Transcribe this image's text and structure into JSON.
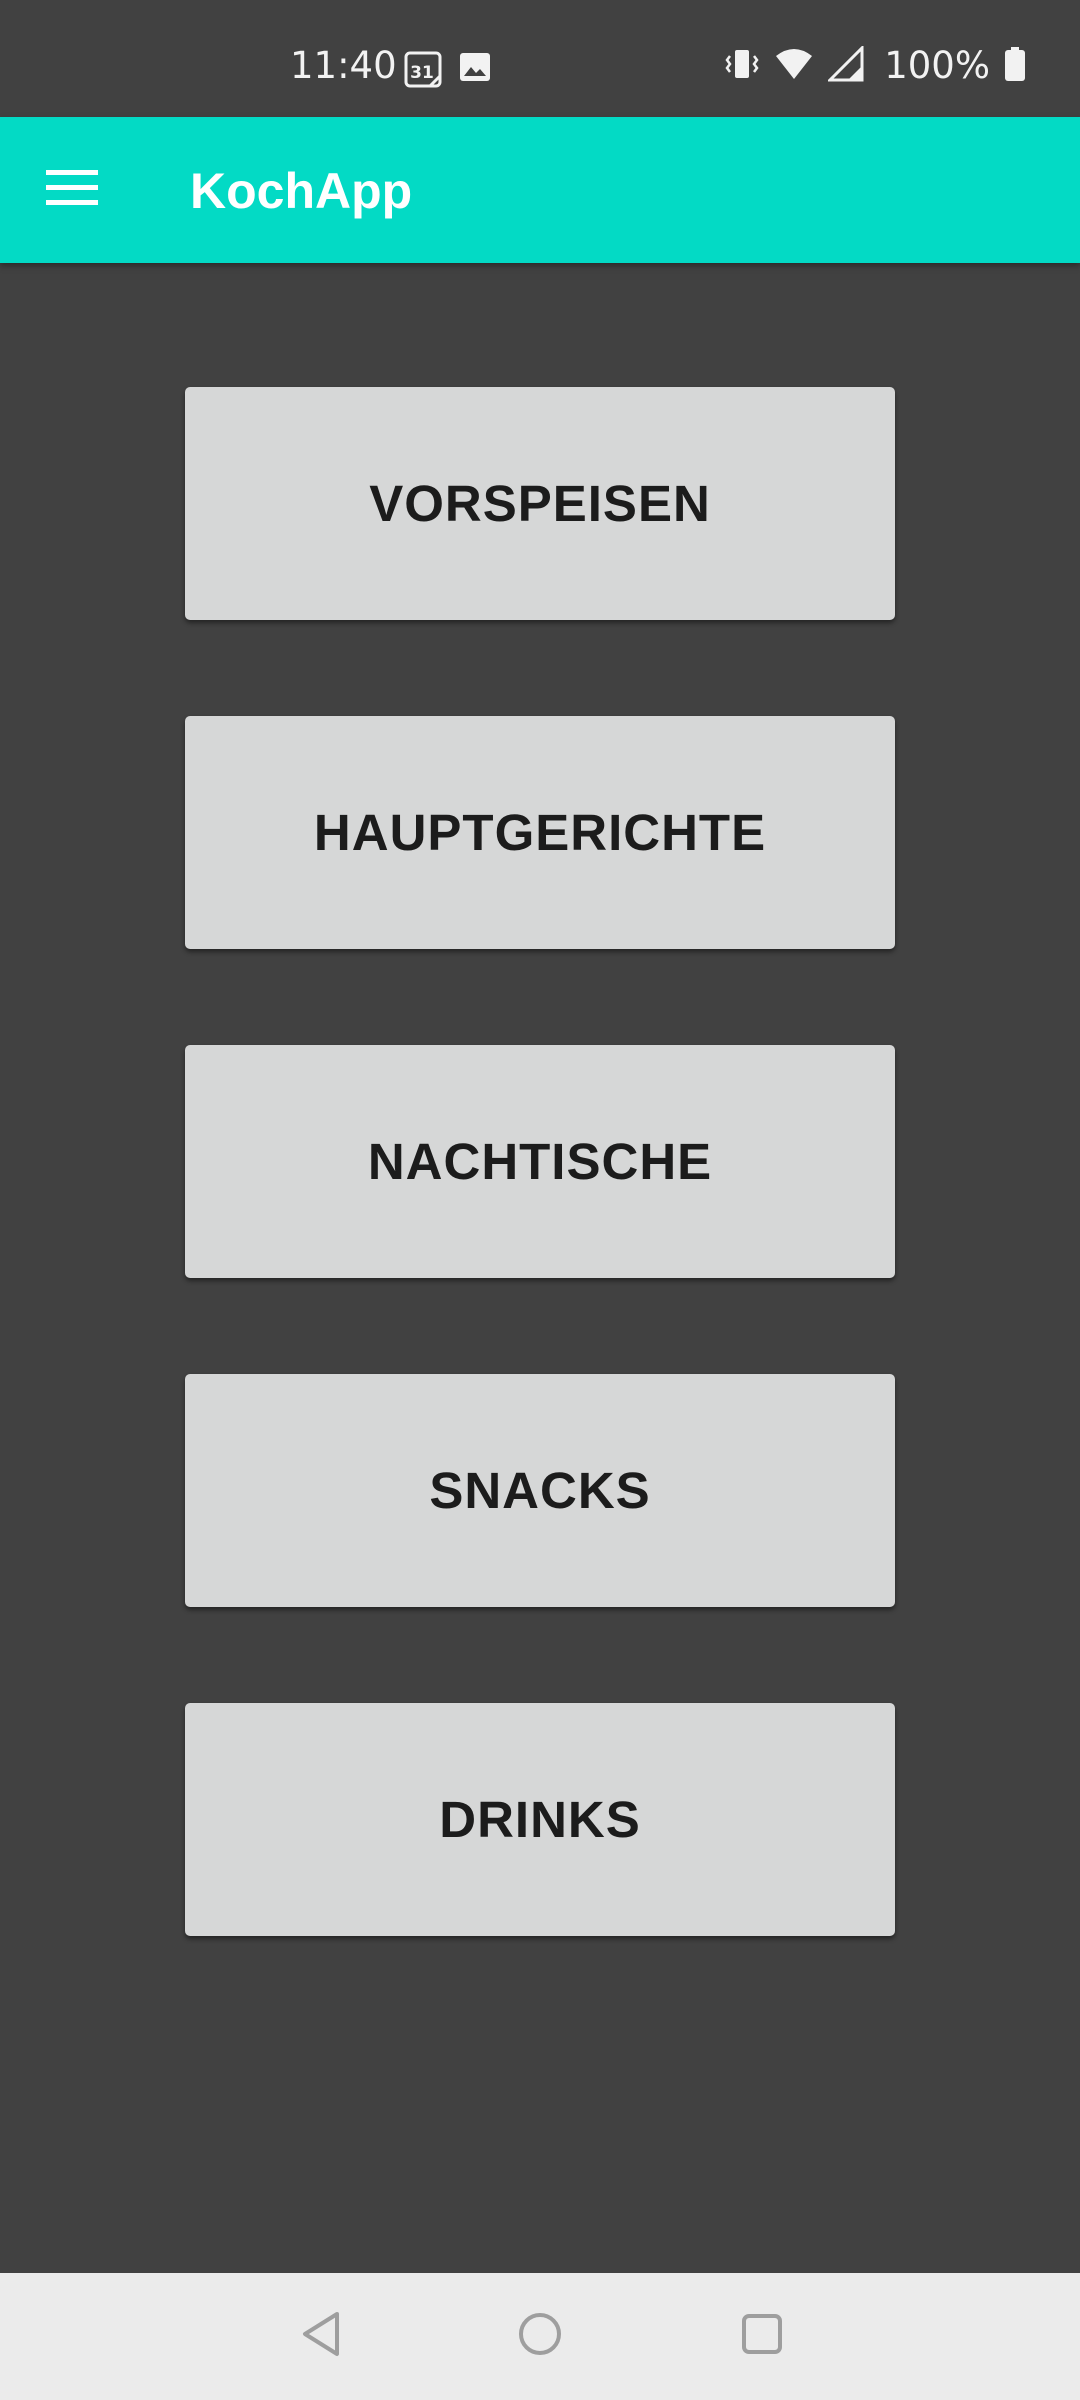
{
  "status_bar": {
    "time": "11:40",
    "calendar_day": "31",
    "battery_percent": "100%",
    "icons": [
      "calendar-icon",
      "image-icon",
      "vibrate-icon",
      "wifi-icon",
      "signal-icon",
      "battery-icon"
    ]
  },
  "app_bar": {
    "title": "KochApp",
    "background_color": "#03dac5",
    "menu_icon": "hamburger-menu-icon"
  },
  "categories": [
    {
      "label": "VORSPEISEN"
    },
    {
      "label": "HAUPTGERICHTE"
    },
    {
      "label": "NACHTISCHE"
    },
    {
      "label": "SNACKS"
    },
    {
      "label": "DRINKS"
    }
  ],
  "navigation_bar": {
    "icons": [
      "back-icon",
      "home-icon",
      "recent-apps-icon"
    ]
  },
  "colors": {
    "background": "#414141",
    "button": "#d6d7d7",
    "button_text": "#1c1c1c",
    "nav_bar": "#ebebeb"
  }
}
